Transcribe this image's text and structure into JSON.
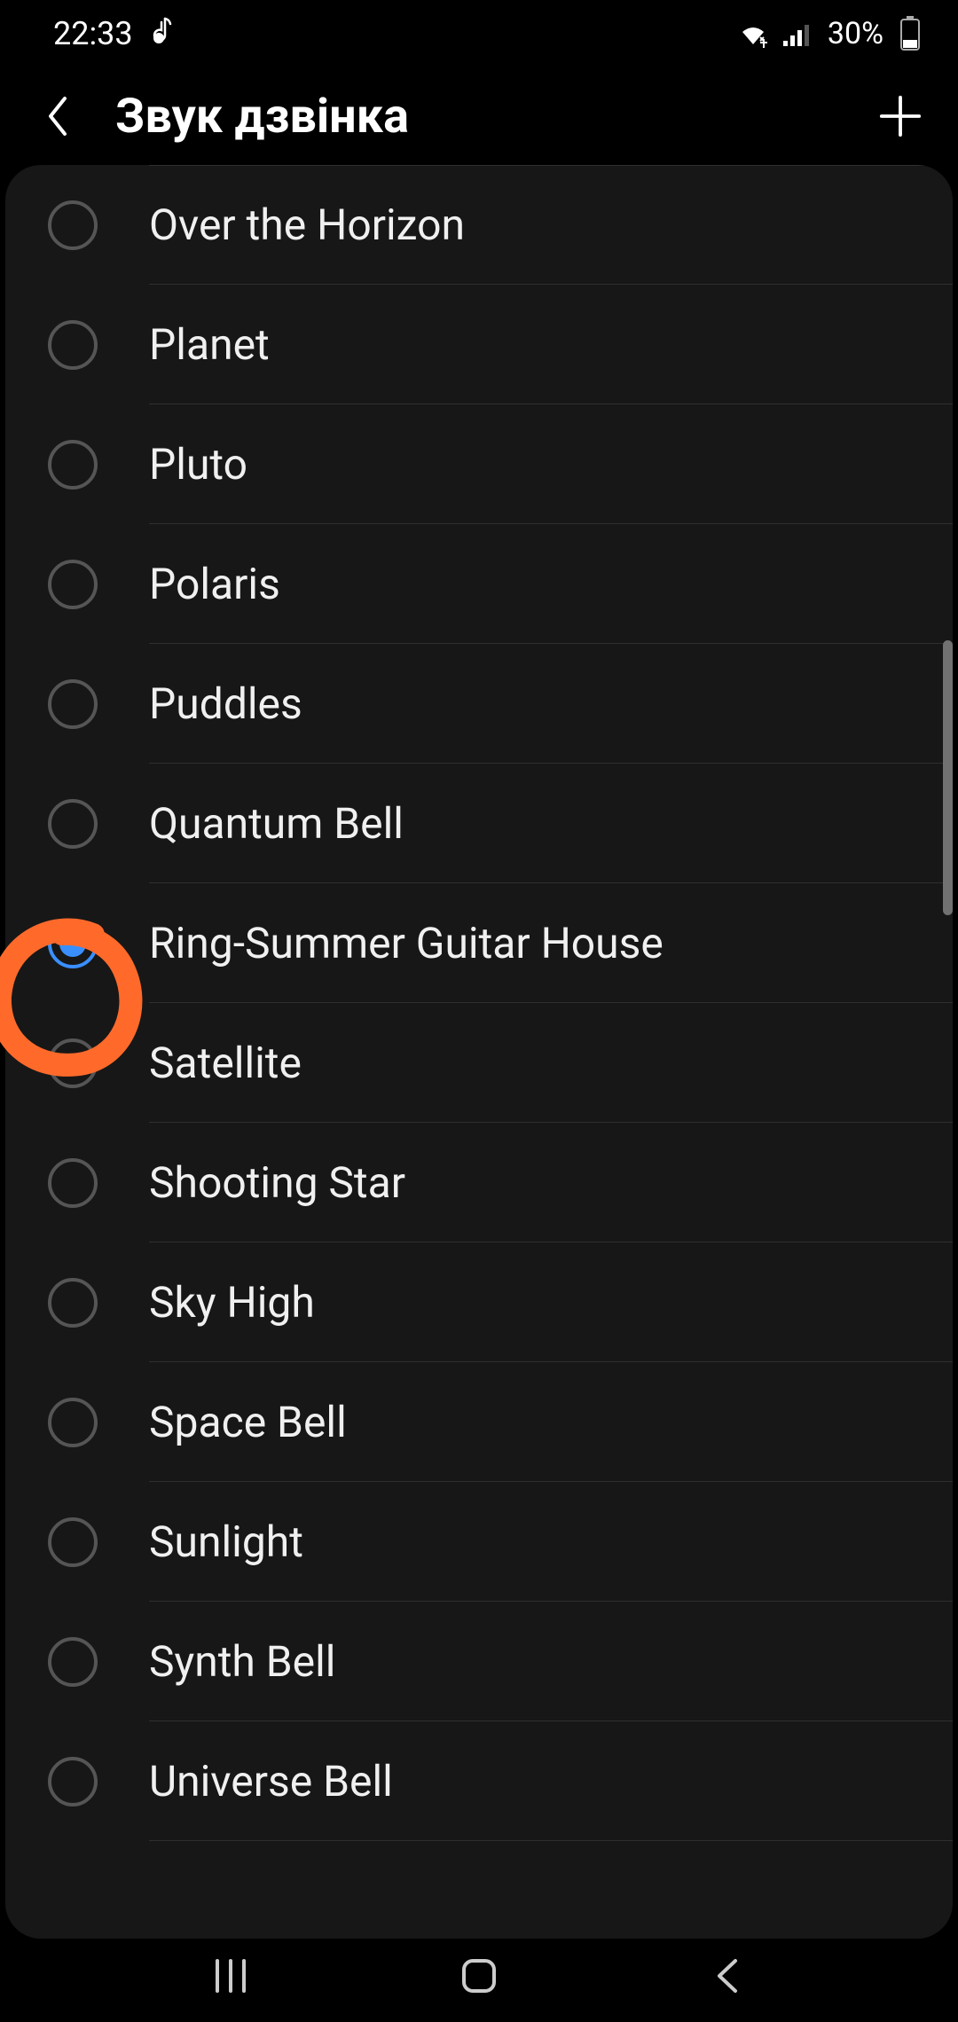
{
  "status": {
    "time": "22:33",
    "battery_pct": "30%"
  },
  "header": {
    "title": "Звук дзвінка"
  },
  "ringtones": [
    {
      "label": "Over the Horizon",
      "selected": false
    },
    {
      "label": "Planet",
      "selected": false
    },
    {
      "label": "Pluto",
      "selected": false
    },
    {
      "label": "Polaris",
      "selected": false
    },
    {
      "label": "Puddles",
      "selected": false
    },
    {
      "label": "Quantum Bell",
      "selected": false
    },
    {
      "label": "Ring-Summer Guitar House",
      "selected": true
    },
    {
      "label": "Satellite",
      "selected": false
    },
    {
      "label": "Shooting Star",
      "selected": false
    },
    {
      "label": "Sky High",
      "selected": false
    },
    {
      "label": "Space Bell",
      "selected": false
    },
    {
      "label": "Sunlight",
      "selected": false
    },
    {
      "label": "Synth Bell",
      "selected": false
    },
    {
      "label": "Universe Bell",
      "selected": false
    }
  ]
}
